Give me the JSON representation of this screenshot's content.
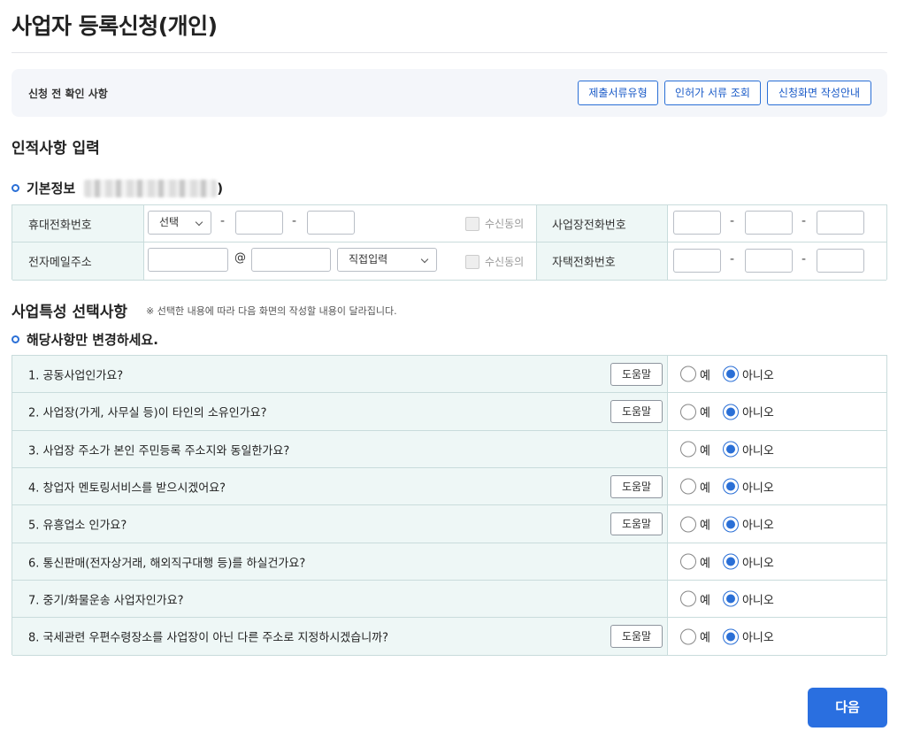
{
  "page_title": "사업자 등록신청(개인)",
  "pre_check": {
    "label": "신청 전 확인 사항",
    "buttons": [
      "제출서류유형",
      "인허가 서류 조회",
      "신청화면 작성안내"
    ]
  },
  "section_personal": "인적사항 입력",
  "basic_info": {
    "title": "기본정보",
    "mobile_label": "휴대전화번호",
    "mobile_select": "선택",
    "email_label": "전자메일주소",
    "email_at": "@",
    "email_domain_select": "직접입력",
    "consent_label": "수신동의",
    "biz_phone_label": "사업장전화번호",
    "home_phone_label": "자택전화번호",
    "dash": "-"
  },
  "section_business": {
    "title": "사업특성 선택사항",
    "note": "※ 선택한 내용에 따라 다음 화면의 작성할 내용이 달라집니다.",
    "sub_title": "해당사항만 변경하세요."
  },
  "radio_labels": {
    "yes": "예",
    "no": "아니오"
  },
  "help_label": "도움말",
  "questions": [
    {
      "text": "1. 공동사업인가요?",
      "help": true,
      "answer": "no"
    },
    {
      "text": "2. 사업장(가게, 사무실 등)이 타인의 소유인가요?",
      "help": true,
      "answer": "no"
    },
    {
      "text": "3. 사업장 주소가 본인 주민등록 주소지와 동일한가요?",
      "help": false,
      "answer": "no"
    },
    {
      "text": "4. 창업자 멘토링서비스를 받으시겠어요?",
      "help": true,
      "answer": "no"
    },
    {
      "text": "5. 유흥업소 인가요?",
      "help": true,
      "answer": "no"
    },
    {
      "text": "6. 통신판매(전자상거래, 해외직구대행 등)를 하실건가요?",
      "help": false,
      "answer": "no"
    },
    {
      "text": "7. 중기/화물운송 사업자인가요?",
      "help": false,
      "answer": "no"
    },
    {
      "text": "8. 국세관련 우편수령장소를 사업장이 아닌 다른 주소로 지정하시겠습니까?",
      "help": true,
      "answer": "no"
    }
  ],
  "next_button": "다음",
  "colors": {
    "accent": "#2a6fd6",
    "table_header_bg": "#eef7f6",
    "table_border": "#c9dcdc"
  }
}
